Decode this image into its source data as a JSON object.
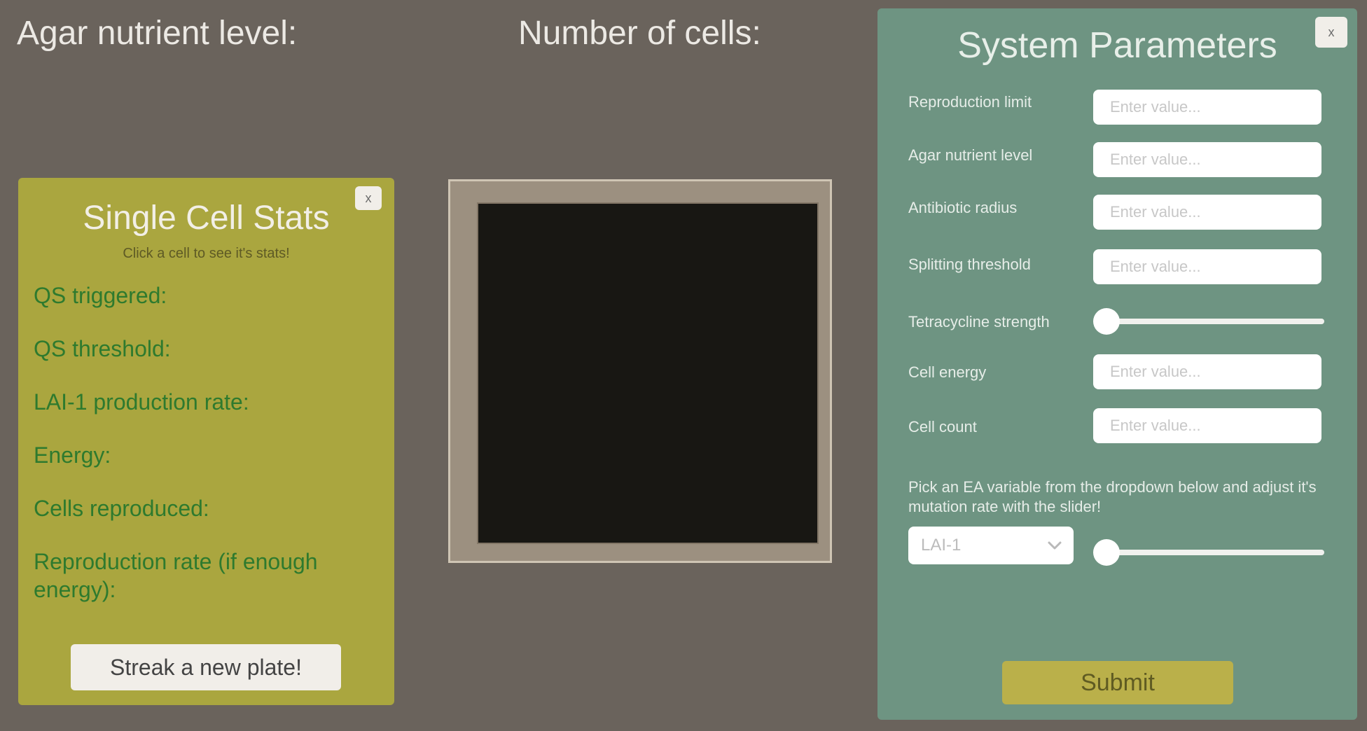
{
  "header": {
    "agar_label": "Agar nutrient level:",
    "cells_label": "Number of cells:"
  },
  "stats_panel": {
    "close_label": "x",
    "title": "Single Cell Stats",
    "subtitle": "Click a cell to see it's stats!",
    "stats": [
      "QS triggered:",
      "QS threshold:",
      "LAI-1 production rate:",
      "Energy:",
      "Cells reproduced:",
      "Reproduction rate (if enough energy):"
    ],
    "streak_button": "Streak a new plate!"
  },
  "params_panel": {
    "close_label": "x",
    "title": "System Parameters",
    "placeholder": "Enter value...",
    "fields": [
      {
        "label": "Reproduction limit"
      },
      {
        "label": "Agar nutrient level"
      },
      {
        "label": "Antibiotic radius"
      },
      {
        "label": "Splitting threshold"
      },
      {
        "label": "Tetracycline strength",
        "slider_value": 0
      },
      {
        "label": "Cell energy"
      },
      {
        "label": "Cell count"
      }
    ],
    "hint": "Pick an EA variable from the dropdown below and adjust it's mutation rate with the slider!",
    "select_value": "LAI-1",
    "mutation_slider_value": 0,
    "submit_label": "Submit"
  },
  "colors": {
    "background": "#6a635c",
    "stats_panel": "#aaa63f",
    "params_panel": "#6e9482",
    "stat_text": "#2e7a2e",
    "submit_button": "#bab04a"
  },
  "icons": {
    "close": "close-icon",
    "dropdown": "chevron-down-icon",
    "slider_thumb": "slider-thumb"
  }
}
